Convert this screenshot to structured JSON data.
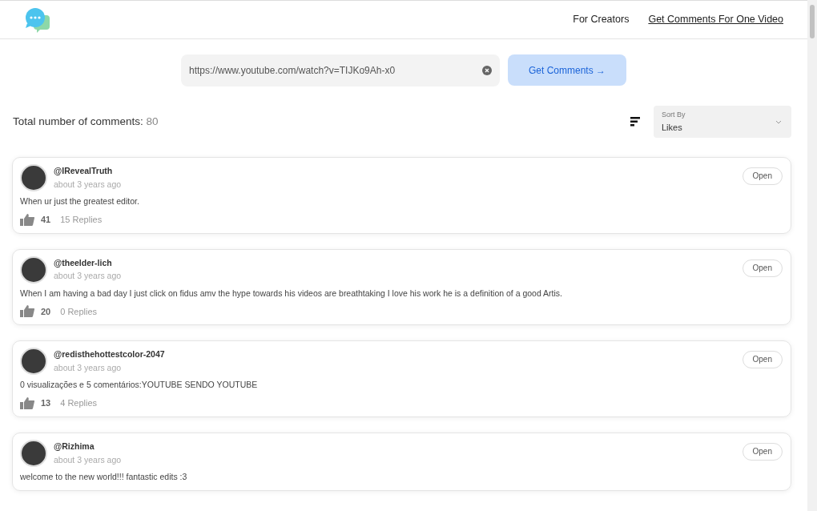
{
  "nav": {
    "links": [
      {
        "label": "For Creators",
        "underlined": false
      },
      {
        "label": "Get Comments For One Video",
        "underlined": true
      }
    ]
  },
  "search": {
    "value": "https://www.youtube.com/watch?v=TIJKo9Ah-x0",
    "button": "Get Comments",
    "button_arrow": "→"
  },
  "summary": {
    "label": "Total number of comments:",
    "count": "80"
  },
  "sort": {
    "label": "Sort By",
    "value": "Likes"
  },
  "comments": [
    {
      "author": "@IRevealTruth",
      "time": "about 3 years ago",
      "text": "When ur just the greatest editor.",
      "likes": "41",
      "replies": "15 Replies",
      "action": "Open"
    },
    {
      "author": "@theelder-lich",
      "time": "about 3 years ago",
      "text": "When I am having a bad day I just click on fidus amv the hype towards his videos are breathtaking I love his work he is a definition of a good Artis.",
      "likes": "20",
      "replies": "0 Replies",
      "action": "Open"
    },
    {
      "author": "@redisthehottestcolor-2047",
      "time": "about 3 years ago",
      "text": "0 visualizações e 5 comentários:YOUTUBE SENDO YOUTUBE",
      "likes": "13",
      "replies": "4 Replies",
      "action": "Open"
    },
    {
      "author": "@Rizhima",
      "time": "about 3 years ago",
      "text": "welcome to the new world!!! fantastic edits :3",
      "action": "Open"
    }
  ]
}
